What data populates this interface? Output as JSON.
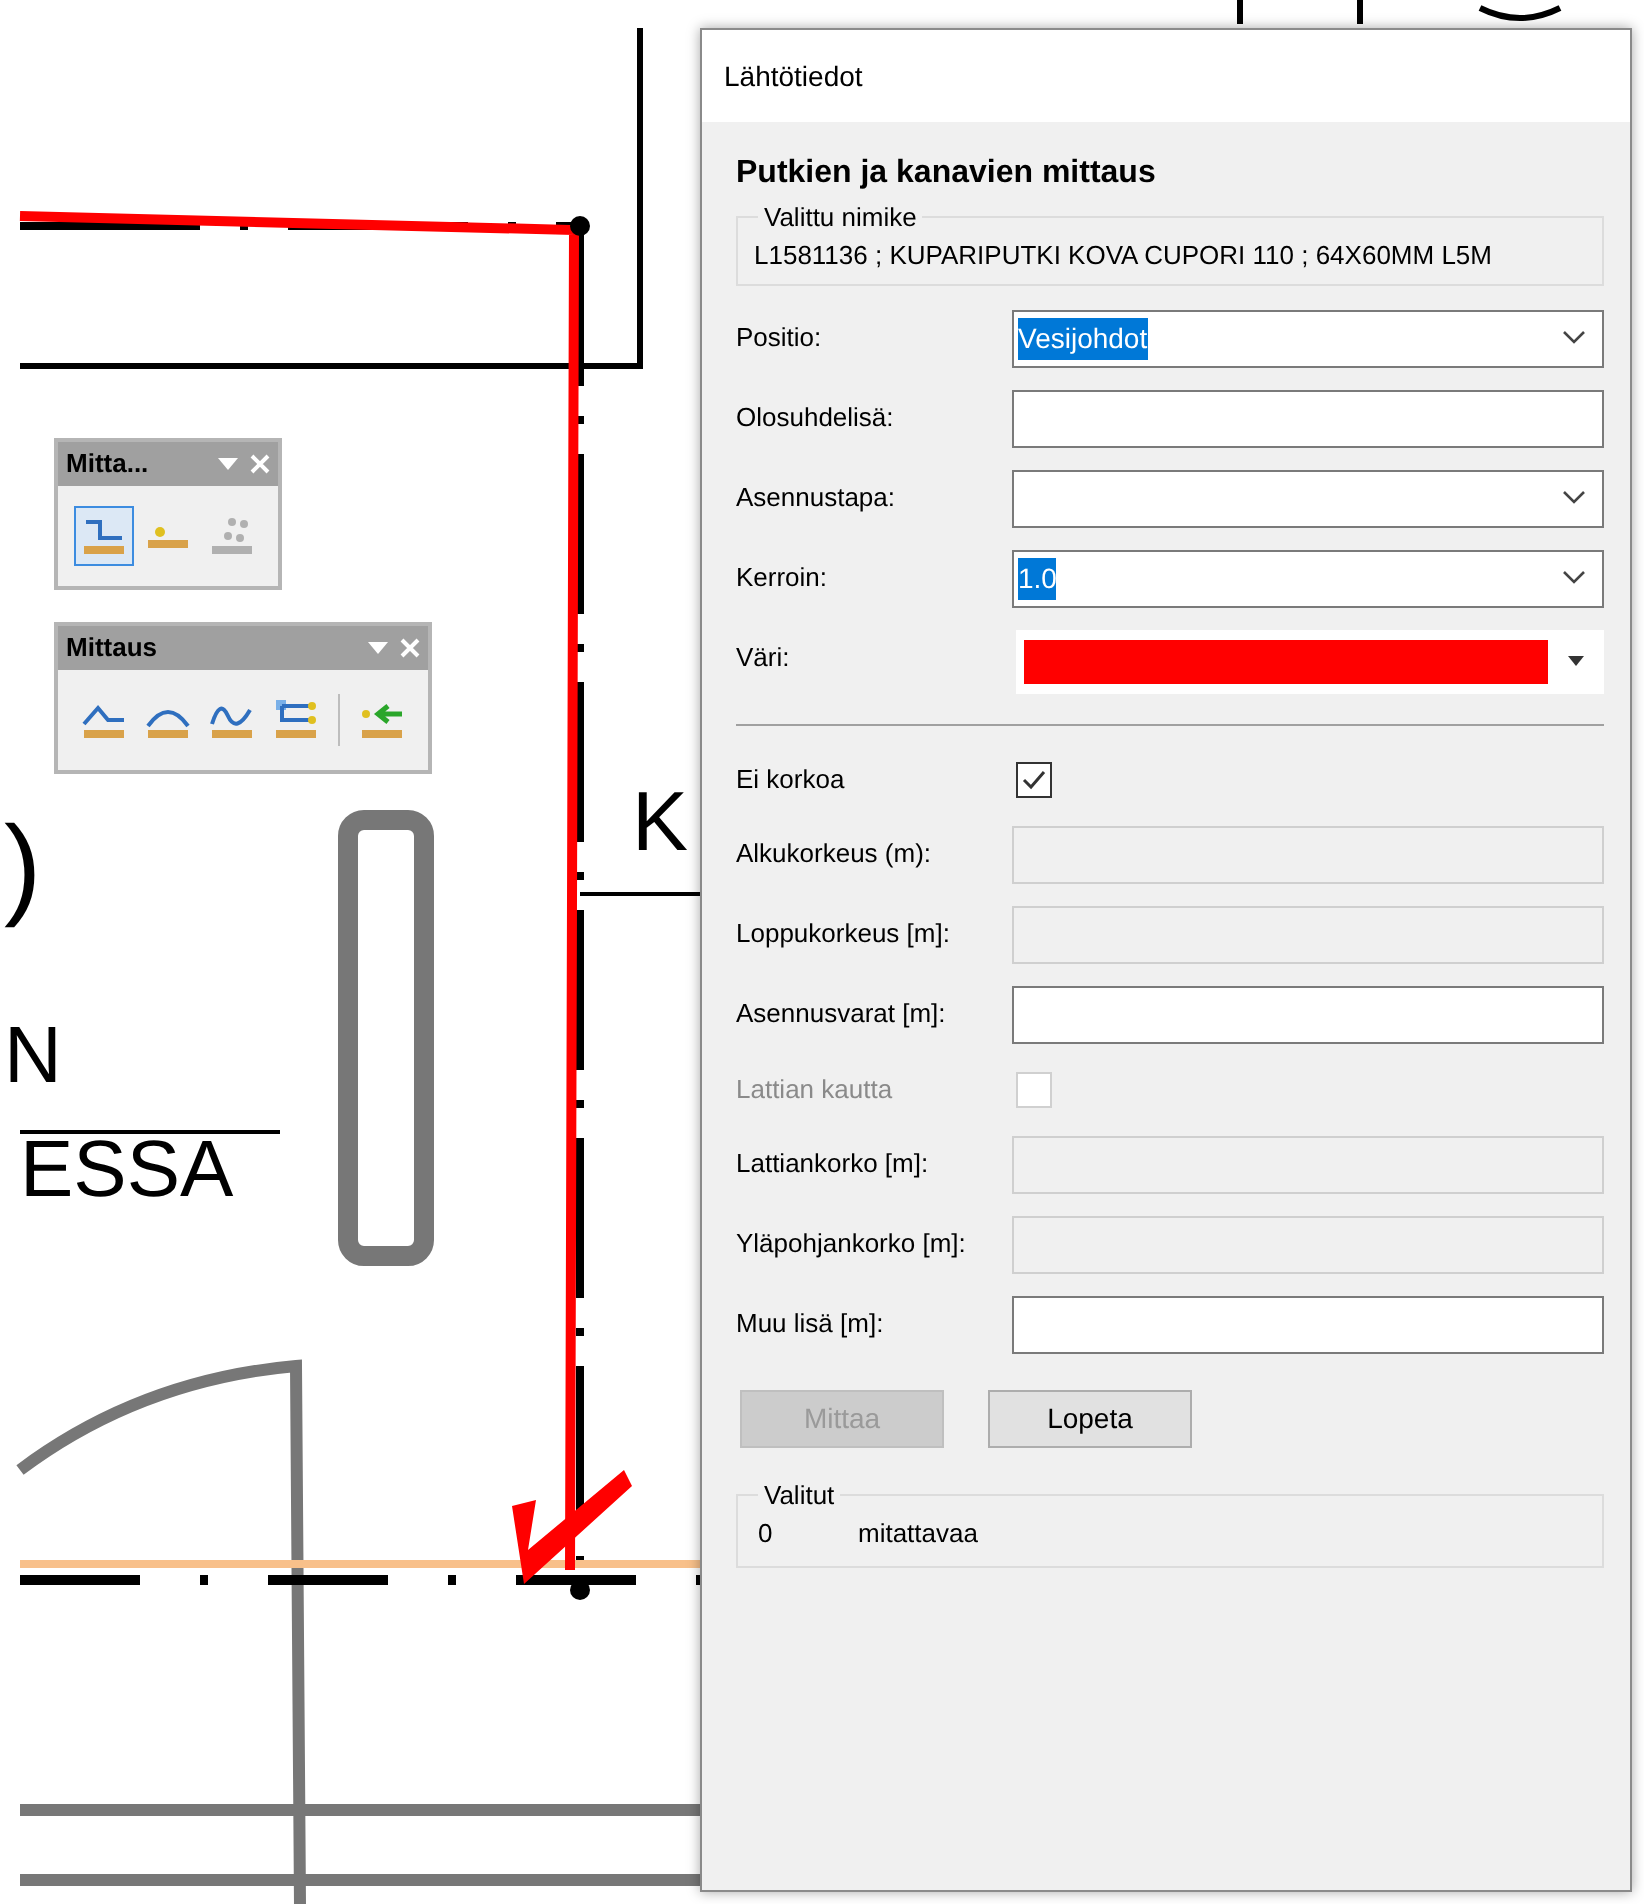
{
  "drawing": {
    "labels": [
      {
        "text": ")",
        "kind": "paren"
      },
      {
        "text": "N",
        "kind": "small"
      },
      {
        "text": "ESSA",
        "kind": "room"
      },
      {
        "text": "K",
        "kind": "edge"
      }
    ]
  },
  "toolbars": [
    {
      "title": "Mitta...",
      "buttons": [
        {
          "kind": "step",
          "selected": true,
          "disabled": false
        },
        {
          "kind": "point",
          "selected": false,
          "disabled": false
        },
        {
          "kind": "cloud",
          "selected": false,
          "disabled": true
        }
      ]
    },
    {
      "title": "Mittaus",
      "buttons": [
        {
          "kind": "peak",
          "selected": false,
          "disabled": false
        },
        {
          "kind": "arc",
          "selected": false,
          "disabled": false
        },
        {
          "kind": "wave",
          "selected": false,
          "disabled": false
        },
        {
          "kind": "bracket",
          "selected": false,
          "disabled": false
        },
        {
          "kind": "separator"
        },
        {
          "kind": "arrow",
          "selected": false,
          "disabled": false
        }
      ]
    }
  ],
  "dialog": {
    "title": "Lähtötiedot",
    "heading": "Putkien ja kanavien mittaus",
    "item_group": {
      "legend": "Valittu nimike",
      "text": "L1581136 ; KUPARIPUTKI KOVA CUPORI 110 ; 64X60MM L5M"
    },
    "fields": [
      {
        "kind": "dropdown",
        "label": "Positio:",
        "value": "Vesijohdot",
        "highlighted": true
      },
      {
        "kind": "text",
        "label": "Olosuhdelisä:",
        "disabled": false
      },
      {
        "kind": "dropdown",
        "label": "Asennustapa:"
      },
      {
        "kind": "dropdown",
        "label": "Kerroin:",
        "value": "1.0",
        "highlighted": true
      },
      {
        "kind": "color",
        "label": "Väri:",
        "color": "#ff0000"
      },
      {
        "kind": "separator"
      },
      {
        "kind": "checkbox",
        "label": "Ei korkoa",
        "checked": true,
        "disabled": false
      },
      {
        "kind": "text",
        "label": "Alkukorkeus (m):",
        "disabled": true
      },
      {
        "kind": "text",
        "label": "Loppukorkeus [m]:",
        "disabled": true
      },
      {
        "kind": "text",
        "label": "Asennusvarat [m]:",
        "disabled": false
      },
      {
        "kind": "checkbox",
        "label": "Lattian kautta",
        "checked": false,
        "disabled": true
      },
      {
        "kind": "text",
        "label": "Lattiankorko [m]:",
        "disabled": true
      },
      {
        "kind": "text",
        "label": "Yläpohjankorko [m]:",
        "disabled": true
      },
      {
        "kind": "text",
        "label": "Muu lisä [m]:",
        "disabled": false
      }
    ],
    "buttons": [
      {
        "label": "Mittaa",
        "disabled": true
      },
      {
        "label": "Lopeta",
        "disabled": false
      }
    ],
    "selected_group": {
      "legend": "Valitut",
      "count": "0",
      "unit": "mitattavaa"
    }
  }
}
